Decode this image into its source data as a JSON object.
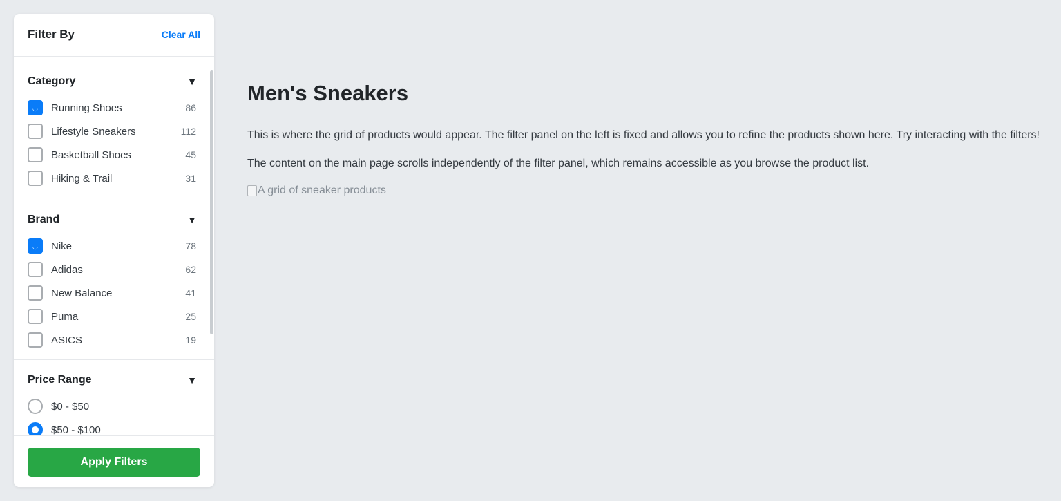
{
  "filter_panel": {
    "title": "Filter By",
    "clear_label": "Clear All",
    "sections": [
      {
        "title": "Category",
        "toggle": "▼",
        "type": "checkbox",
        "options": [
          {
            "label": "Running Shoes",
            "count": "86",
            "checked": true
          },
          {
            "label": "Lifestyle Sneakers",
            "count": "112",
            "checked": false
          },
          {
            "label": "Basketball Shoes",
            "count": "45",
            "checked": false
          },
          {
            "label": "Hiking & Trail",
            "count": "31",
            "checked": false
          }
        ]
      },
      {
        "title": "Brand",
        "toggle": "▼",
        "type": "checkbox",
        "options": [
          {
            "label": "Nike",
            "count": "78",
            "checked": true
          },
          {
            "label": "Adidas",
            "count": "62",
            "checked": false
          },
          {
            "label": "New Balance",
            "count": "41",
            "checked": false
          },
          {
            "label": "Puma",
            "count": "25",
            "checked": false
          },
          {
            "label": "ASICS",
            "count": "19",
            "checked": false
          }
        ]
      },
      {
        "title": "Price Range",
        "toggle": "▼",
        "type": "radio",
        "options": [
          {
            "label": "$0 - $50",
            "checked": false
          },
          {
            "label": "$50 - $100",
            "checked": true
          }
        ]
      }
    ],
    "apply_label": "Apply Filters"
  },
  "main": {
    "title": "Men's Sneakers",
    "paragraphs": [
      "This is where the grid of products would appear. The filter panel on the left is fixed and allows you to refine the products shown here. Try interacting with the filters!",
      "The content on the main page scrolls independently of the filter panel, which remains accessible as you browse the product list."
    ],
    "image_alt": "A grid of sneaker products"
  },
  "colors": {
    "accent": "#0a7cf8",
    "apply_button": "#28a745",
    "page_background": "#e8ebee"
  },
  "icons": {
    "toggle": "chevron-down-icon",
    "check": "checkmark-icon",
    "broken_image": "broken-image-icon"
  }
}
